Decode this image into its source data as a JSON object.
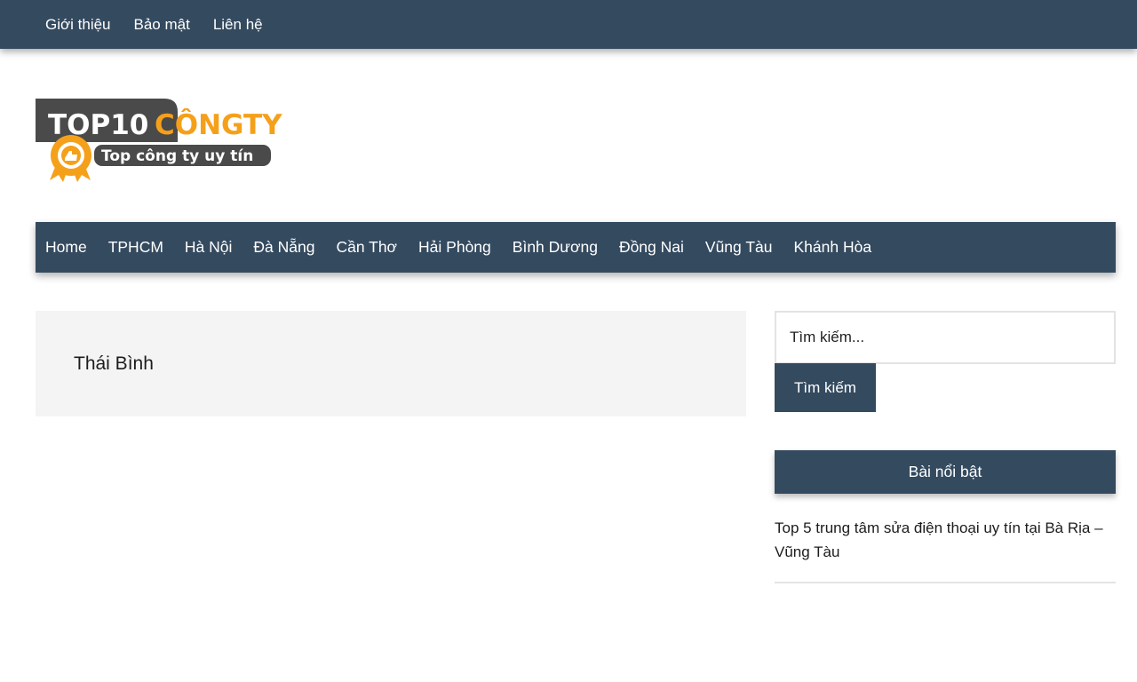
{
  "top_nav": {
    "items": [
      "Giới thiệu",
      "Bảo mật",
      "Liên hệ"
    ]
  },
  "logo": {
    "word_top": "TOP10",
    "word_brand": "CÔNGTY",
    "tagline": "Top công ty uy tín",
    "colors": {
      "dark": "#4a4a4a",
      "orange": "#f5a01a"
    }
  },
  "main_nav": {
    "items": [
      "Home",
      "TPHCM",
      "Hà Nội",
      "Đà Nẵng",
      "Cần Thơ",
      "Hải Phòng",
      "Bình Dương",
      "Đồng Nai",
      "Vũng Tàu",
      "Khánh Hòa"
    ]
  },
  "archive": {
    "title": "Thái Bình"
  },
  "sidebar": {
    "search": {
      "placeholder": "Tìm kiếm...",
      "button_label": "Tìm kiếm"
    },
    "featured": {
      "title": "Bài nổi bật",
      "posts": [
        "Top 5 trung tâm sửa điện thoại uy tín tại Bà Rịa – Vũng Tàu"
      ]
    }
  },
  "colors": {
    "nav_bg": "#344a5f",
    "archive_bg": "#f4f4f4",
    "border": "#e3e3e3"
  }
}
